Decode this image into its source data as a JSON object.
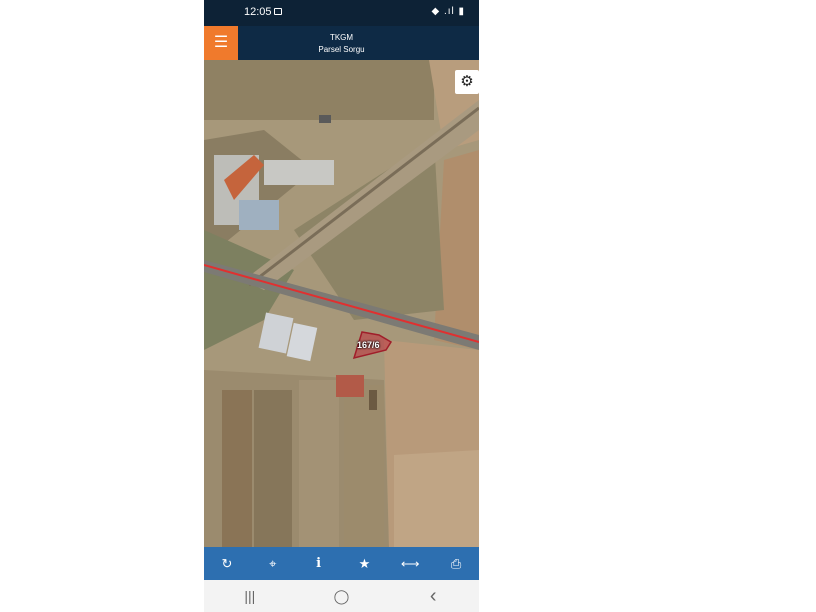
{
  "status": {
    "time": "12:05",
    "icons": "◆ .ıl ▮"
  },
  "app": {
    "title": "TKGM",
    "subtitle": "Parsel Sorgu",
    "accent": "#f07a2c",
    "header_color": "#0e2a45"
  },
  "map": {
    "parcel_label": "167/6",
    "parcel_color": "#c0303c",
    "road_color": "#e03030"
  },
  "toolbar": {
    "color": "#2d6fb0",
    "buttons": [
      {
        "icon": "refresh-icon",
        "glyph": "↻"
      },
      {
        "icon": "locate-icon",
        "glyph": "⌖"
      },
      {
        "icon": "info-icon",
        "glyph": "i"
      },
      {
        "icon": "star-icon",
        "glyph": "★"
      },
      {
        "icon": "measure-icon",
        "glyph": "⟷"
      },
      {
        "icon": "print-icon",
        "glyph": "⎙"
      }
    ]
  },
  "nav": {
    "recent": "|||",
    "home": "◯",
    "back": "‹"
  }
}
